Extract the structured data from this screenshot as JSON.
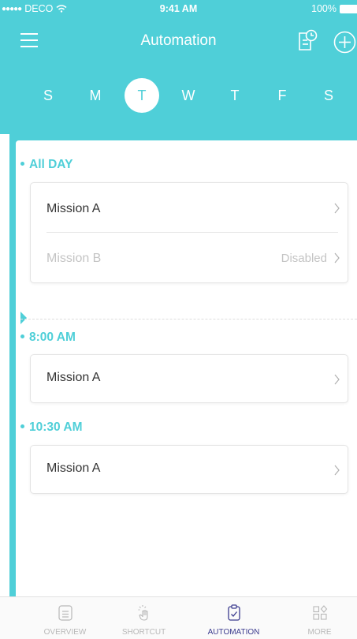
{
  "status_bar": {
    "carrier": "DECO",
    "time": "9:41 AM",
    "battery": "100%"
  },
  "header": {
    "title": "Automation"
  },
  "days": [
    {
      "label": "S",
      "selected": false
    },
    {
      "label": "M",
      "selected": false
    },
    {
      "label": "T",
      "selected": true
    },
    {
      "label": "W",
      "selected": false
    },
    {
      "label": "T",
      "selected": false
    },
    {
      "label": "F",
      "selected": false
    },
    {
      "label": "S",
      "selected": false
    }
  ],
  "sections": [
    {
      "heading": "All DAY",
      "missions": [
        {
          "name": "Mission A",
          "status": "",
          "disabled": false
        },
        {
          "name": "Mission B",
          "status": "Disabled",
          "disabled": true
        }
      ]
    },
    {
      "heading": "8:00 AM",
      "missions": [
        {
          "name": "Mission A",
          "status": "",
          "disabled": false
        }
      ]
    },
    {
      "heading": "10:30 AM",
      "missions": [
        {
          "name": "Mission A",
          "status": "",
          "disabled": false
        }
      ]
    }
  ],
  "tabs": [
    {
      "label": "OVERVIEW",
      "icon": "overview-icon",
      "active": false
    },
    {
      "label": "SHORTCUT",
      "icon": "tap-icon",
      "active": false
    },
    {
      "label": "AUTOMATION",
      "icon": "clipboard-check-icon",
      "active": true
    },
    {
      "label": "MORE",
      "icon": "grid-icon",
      "active": false
    }
  ],
  "colors": {
    "accent": "#4fcfd8",
    "active_tab": "#3b3b8e",
    "disabled_text": "#c4c4c4"
  }
}
